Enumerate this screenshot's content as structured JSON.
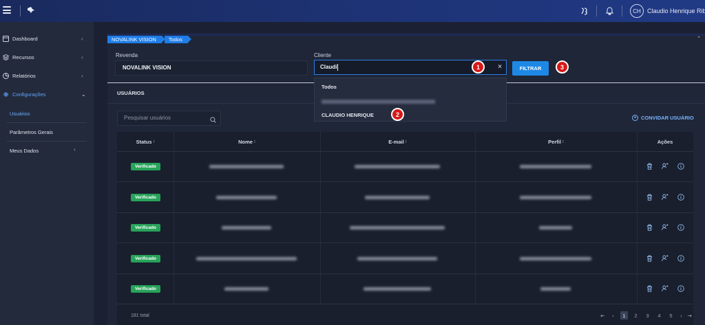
{
  "topbar": {
    "avatar_initials": "CH",
    "user_name": "Claudio Henrique Ribe"
  },
  "sidebar": {
    "items": [
      {
        "label": "Dashboard",
        "icon": "dashboard-icon"
      },
      {
        "label": "Recursos",
        "icon": "layers-icon"
      },
      {
        "label": "Relatórios",
        "icon": "chart-pie-icon"
      },
      {
        "label": "Configurações",
        "icon": "gear-icon"
      }
    ],
    "sub_items": [
      "Usuários",
      "Parâmetros Gerais",
      "Meus Dados"
    ]
  },
  "breadcrumb": [
    "NOVALINK VISION",
    "Todos"
  ],
  "filters": {
    "revenda_label": "Revenda",
    "revenda_value": "NOVALINK VISION",
    "cliente_label": "Cliente",
    "cliente_value": "Claudi",
    "filter_button": "FILTRAR"
  },
  "dropdown": {
    "options": [
      "Todos",
      "CLAUDIO HENRIQUE"
    ]
  },
  "markers": [
    "1",
    "2",
    "3"
  ],
  "section_title": "USUÁRIOS",
  "search": {
    "placeholder": "Pesquisar usuários"
  },
  "invite_label": "CONVIDAR USUÁRIO",
  "table": {
    "headers": [
      "Status",
      "Nome",
      "E-mail",
      "Perfil",
      "Ações"
    ],
    "rows": [
      {
        "status": "Verificado"
      },
      {
        "status": "Verificado"
      },
      {
        "status": "Verificado"
      },
      {
        "status": "Verificado"
      },
      {
        "status": "Verificado"
      }
    ],
    "total": "181 total",
    "pages": [
      "1",
      "2",
      "3",
      "4",
      "5"
    ]
  },
  "colors": {
    "accent": "#1e88e5",
    "topbar": "#1e3478",
    "badge": "#27a35a",
    "marker": "#d81818"
  }
}
